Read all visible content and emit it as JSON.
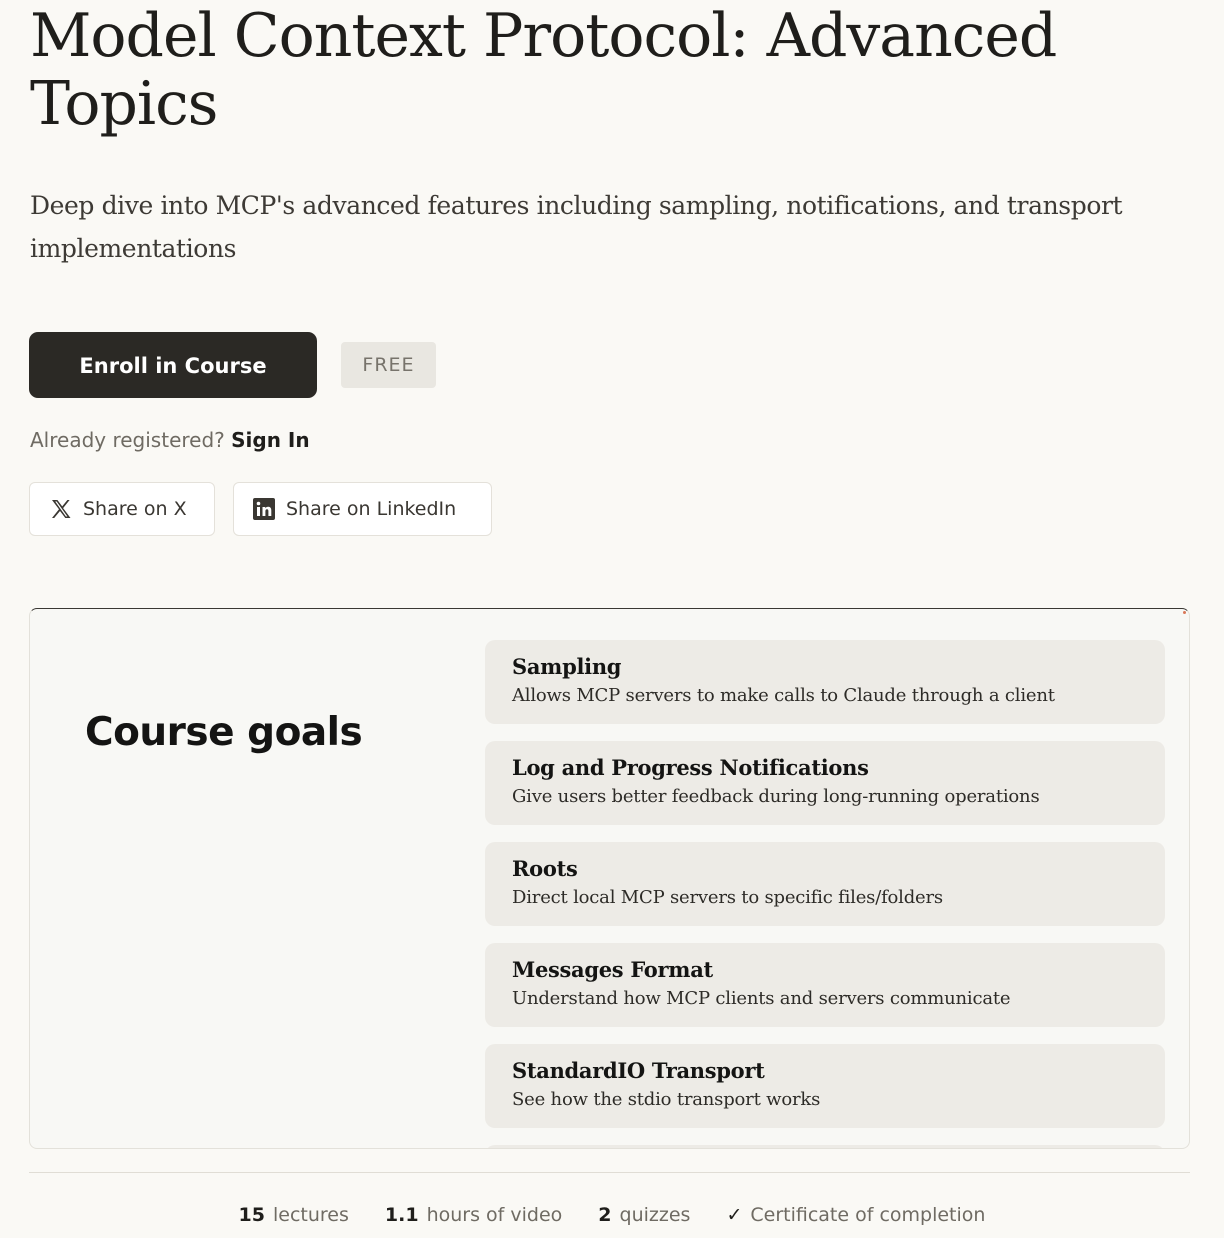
{
  "course": {
    "title": "Model Context Protocol: Advanced Topics",
    "subtitle": "Deep dive into MCP's advanced features including sampling, notifications, and transport implementations"
  },
  "enroll": {
    "button_label": "Enroll in Course",
    "price_badge": "FREE"
  },
  "signin": {
    "prompt": "Already registered?",
    "link_label": "Sign In"
  },
  "share": {
    "x_label": "Share on X",
    "linkedin_label": "Share on LinkedIn",
    "x_icon": "x-logo-icon",
    "linkedin_icon": "linkedin-logo-icon"
  },
  "goals": {
    "heading": "Course goals",
    "items": [
      {
        "title": "Sampling",
        "description": "Allows MCP servers to make calls to Claude through a client"
      },
      {
        "title": "Log and Progress Notifications",
        "description": "Give users better feedback during long-running operations"
      },
      {
        "title": "Roots",
        "description": "Direct local MCP servers to specific files/folders"
      },
      {
        "title": "Messages Format",
        "description": "Understand how MCP clients and servers communicate"
      },
      {
        "title": "StandardIO Transport",
        "description": "See how the stdio transport works"
      }
    ]
  },
  "stats": {
    "lectures_count": "15",
    "lectures_label": "lectures",
    "video_hours": "1.1",
    "video_label": "hours of video",
    "quizzes_count": "2",
    "quizzes_label": "quizzes",
    "check_glyph": "✓",
    "certificate_label": "Certificate of completion"
  },
  "colors": {
    "page_background": "#faf9f5",
    "primary_button": "#2b2925",
    "goal_card": "#edebe6",
    "accent_dot": "#d97757"
  }
}
